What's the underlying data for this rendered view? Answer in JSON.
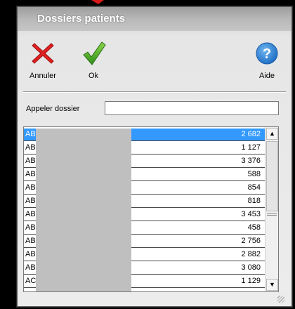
{
  "window": {
    "title": "Dossiers patients"
  },
  "toolbar": {
    "cancel_label": "Annuler",
    "ok_label": "Ok",
    "help_label": "Aide",
    "colors": {
      "cancel": "#e02020",
      "ok": "#4caf2a",
      "help": "#2c82d6"
    }
  },
  "search": {
    "label": "Appeler dossier",
    "value": ""
  },
  "list": {
    "rows": [
      {
        "code": "AB",
        "value": "2 682",
        "selected": true
      },
      {
        "code": "AB",
        "value": "1 127"
      },
      {
        "code": "AB",
        "value": "3 376"
      },
      {
        "code": "AB",
        "value": "588"
      },
      {
        "code": "AB",
        "value": "854"
      },
      {
        "code": "AB",
        "value": "818"
      },
      {
        "code": "AB",
        "value": "3 453"
      },
      {
        "code": "AB",
        "value": "458"
      },
      {
        "code": "AB",
        "value": "2 756"
      },
      {
        "code": "AB",
        "value": "2 882"
      },
      {
        "code": "AB",
        "value": "3 080"
      },
      {
        "code": "AC",
        "value": "1 129"
      }
    ]
  },
  "colors": {
    "selection": "#3399ff"
  }
}
